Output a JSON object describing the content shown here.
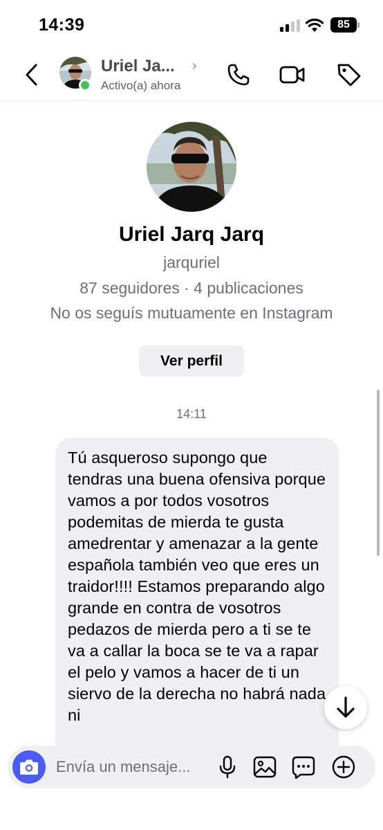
{
  "status_bar": {
    "time": "14:39",
    "battery": "85",
    "icons": [
      "signal-icon",
      "wifi-icon",
      "battery-icon"
    ]
  },
  "header": {
    "name": "Uriel Ja...",
    "status": "Activo(a) ahora",
    "icons": [
      "back-icon",
      "phone-icon",
      "video-icon",
      "tag-icon"
    ]
  },
  "profile": {
    "name": "Uriel Jarq Jarq",
    "username": "jarquriel",
    "stats": "87 seguidores · 4 publicaciones",
    "mutual": "No os seguís mutuamente en Instagram",
    "view_profile_label": "Ver perfil"
  },
  "thread": {
    "timestamp": "14:11",
    "messages": [
      {
        "text": "Tú asqueroso supongo que tendras una buena ofensiva porque vamos a por todos vosotros podemitas de mierda te gusta amedrentar y amenazar a la gente española también veo que eres un traidor!!!! Estamos preparando algo grande en contra de vosotros pedazos de mierda pero a ti se te va a callar la boca se te va a rapar el pelo y vamos a hacer de ti un siervo de la derecha no habrá nada ni"
      }
    ]
  },
  "composer": {
    "placeholder": "Envía un mensaje...",
    "icons": [
      "camera-icon",
      "microphone-icon",
      "gallery-icon",
      "sticker-icon",
      "plus-icon"
    ]
  },
  "colors": {
    "online": "#3ec552",
    "camera_button": "#4a5cf5",
    "bubble": "#efeff4"
  }
}
